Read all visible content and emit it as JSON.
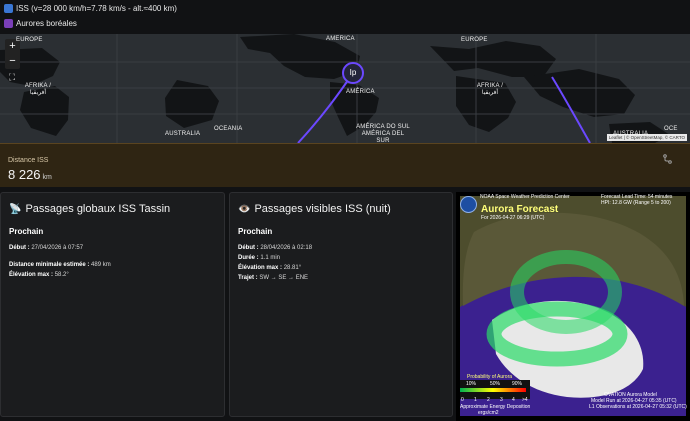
{
  "header": {
    "iss_label": "ISS (v=28 000 km/h=7.78 km/s - alt.≈400 km)",
    "aurora_label": "Aurores boréales"
  },
  "map": {
    "zoom_in": "+",
    "zoom_out": "−",
    "fullscreen": "⛶",
    "marker": "Ip",
    "labels": {
      "europe_left": "EUROPE",
      "america": "AMERICA",
      "europe_right": "EUROPE",
      "afrika_left": "AFRIKA / أفريقيا",
      "america_center": "AMÉRICA",
      "afrika_right": "AFRIKA / أفريقيا",
      "australia_left": "AUSTRALIA",
      "oceania": "OCEANIA",
      "south_america": "AMÉRICA DO SUL AMÉRICA DEL SUR",
      "australia_right": "AUSTRALIA",
      "oce_right": "OCE"
    },
    "attribution": "Leaflet | © OpenStreetMap, © CARTO"
  },
  "distance": {
    "label": "Distance ISS",
    "value": "8 226",
    "unit": "km",
    "icon": "route-icon"
  },
  "global_passes": {
    "title": "Passages globaux ISS Tassin",
    "subtitle": "Prochain",
    "start_label": "Début :",
    "start_value": "27/04/2026 à 07:57",
    "min_distance_label": "Distance minimale estimée :",
    "min_distance_value": "489 km",
    "max_elevation_label": "Élévation max :",
    "max_elevation_value": "58.2°"
  },
  "visible_passes": {
    "title": "Passages visibles ISS (nuit)",
    "subtitle": "Prochain",
    "start_label": "Début :",
    "start_value": "28/04/2026 à 02:18",
    "duration_label": "Durée :",
    "duration_value": "1.1 min",
    "max_elevation_label": "Élévation max :",
    "max_elevation_value": "28.81°",
    "trajectory_label": "Trajet :",
    "trajectory_value": "SW → SE → ENE"
  },
  "aurora": {
    "center": "NOAA Space Weather Prediction Center",
    "forecast_time_label": "Forecast Lead Time: 54 minutes",
    "hpi": "HPI: 12.8 GW (Range 5 to 200)",
    "title": "Aurora Forecast",
    "for_time": "For 2026-04-27 06:29 (UTC)",
    "prob_title": "Probability of Aurora",
    "prob_ticks": [
      "10%",
      "50%",
      "90%"
    ],
    "scale_ticks": [
      "0",
      "1",
      "2",
      "3",
      "4",
      ">4"
    ],
    "approx_energy": "Approximate Energy Deposition",
    "energy_unit": "ergs/cm2",
    "model": "OVATION Aurora Model",
    "model_run": "Model Run at 2026-04-27 05:35 (UTC)",
    "l1": "L1 Observations at 2026-04-27 05:32 (UTC)",
    "colors": {
      "green": "#33d96d",
      "purple": "#3b218f"
    }
  }
}
